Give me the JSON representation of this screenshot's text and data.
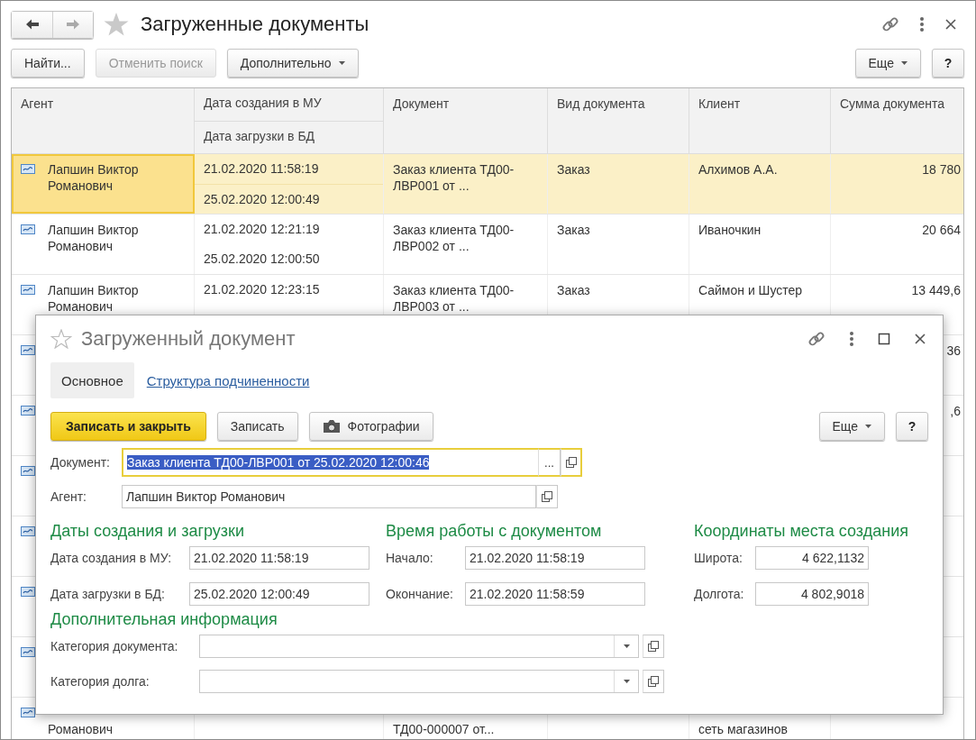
{
  "window": {
    "title": "Загруженные документы",
    "nav": [
      {
        "kind": "back",
        "disabled": false
      },
      {
        "kind": "forward",
        "disabled": true
      }
    ]
  },
  "toolbar": {
    "buttons": [
      {
        "label": "Найти...",
        "disabled": false,
        "dropdown": false
      },
      {
        "label": "Отменить поиск",
        "disabled": true,
        "dropdown": false
      },
      {
        "label": "Дополнительно",
        "disabled": false,
        "dropdown": true
      }
    ],
    "more_button": "Еще",
    "help_button": "?"
  },
  "table": {
    "columns": [
      "Агент",
      "Дата создания в МУ",
      "Дата загрузки в БД",
      "Документ",
      "Вид документа",
      "Клиент",
      "Сумма документа"
    ],
    "rows": [
      {
        "kind": "full",
        "selected": true,
        "agent": "Лапшин Виктор Романович",
        "created": "21.02.2020 11:58:19",
        "loaded": "25.02.2020 12:00:49",
        "document": "Заказ клиента ТД00-ЛВР001 от ...",
        "doc_kind": "Заказ",
        "client": "Алхимов А.А.",
        "sum": "18 780"
      },
      {
        "kind": "full",
        "selected": false,
        "agent": "Лапшин Виктор Романович",
        "created": "21.02.2020 12:21:19",
        "loaded": "25.02.2020 12:00:50",
        "document": "Заказ клиента ТД00-ЛВР002 от ...",
        "doc_kind": "Заказ",
        "client": "Иваночкин",
        "sum": "20 664"
      },
      {
        "kind": "full",
        "selected": false,
        "agent": "Лапшин Виктор Романович",
        "created": "21.02.2020 12:23:15",
        "document": "Заказ клиента ТД00-ЛВР003 от ...",
        "doc_kind": "Заказ",
        "client": "Саймон и Шустер",
        "sum": "13 449,6"
      },
      {
        "kind": "full",
        "selected": false,
        "sum": "36"
      },
      {
        "kind": "full",
        "selected": false,
        "sum": ",6"
      },
      {
        "kind": "full",
        "selected": false
      },
      {
        "kind": "full",
        "selected": false
      },
      {
        "kind": "full",
        "selected": false
      },
      {
        "kind": "full",
        "selected": false
      },
      {
        "kind": "cut_top",
        "selected": false,
        "agent": "Романович",
        "document": "ТД00-000007 от...",
        "client": "сеть магазинов"
      }
    ]
  },
  "dialog": {
    "title": "Загруженный документ",
    "tabs": [
      {
        "label": "Основное",
        "selected": true
      },
      {
        "label": "Структура подчиненности",
        "selected": false
      }
    ],
    "buttons": [
      {
        "label": "Записать и закрыть",
        "kind": "primary"
      },
      {
        "label": "Записать",
        "kind": "plain"
      },
      {
        "label": "Фотографии",
        "kind": "photo"
      }
    ],
    "more_button": "Еще",
    "help_button": "?",
    "fields": [
      {
        "label": "Документ:",
        "value": "Заказ клиента ТД00-ЛВР001 от 25.02.2020 12:00:46",
        "focused": true,
        "choice_button": "..."
      },
      {
        "label": "Агент:",
        "value": "Лапшин Виктор Романович",
        "focused": false
      }
    ],
    "groups": [
      {
        "title": "Даты создания и загрузки",
        "fields": [
          {
            "label": "Дата создания в МУ:",
            "value": "21.02.2020 11:58:19"
          },
          {
            "label": "Дата загрузки в БД:",
            "value": "25.02.2020 12:00:49"
          }
        ]
      },
      {
        "title": "Время работы с документом",
        "fields": [
          {
            "label": "Начало:",
            "value": "21.02.2020 11:58:19"
          },
          {
            "label": "Окончание:",
            "value": "21.02.2020 11:58:59"
          }
        ]
      },
      {
        "title": "Координаты места создания",
        "fields": [
          {
            "label": "Широта:",
            "value": "4 622,1132"
          },
          {
            "label": "Долгота:",
            "value": "4 802,9018"
          }
        ]
      }
    ],
    "extra": {
      "title": "Дополнительная информация",
      "fields": [
        {
          "label": "Категория документа:"
        },
        {
          "label": "Категория долга:"
        }
      ]
    }
  }
}
